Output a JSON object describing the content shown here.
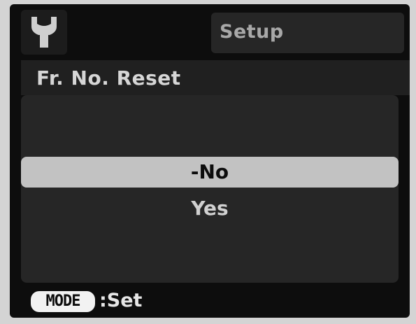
{
  "header": {
    "icon": "wrench-icon",
    "menu_title": "Setup"
  },
  "setting": {
    "title": "Fr. No. Reset"
  },
  "options": [
    {
      "label": "-No",
      "selected": true
    },
    {
      "label": "Yes",
      "selected": false
    }
  ],
  "footer": {
    "button_label": "MODE",
    "action_text": ":Set"
  },
  "colors": {
    "screen_background": "#0d0d0d",
    "highlight": "#c2c2c2",
    "text_light": "#d0d0d0"
  }
}
